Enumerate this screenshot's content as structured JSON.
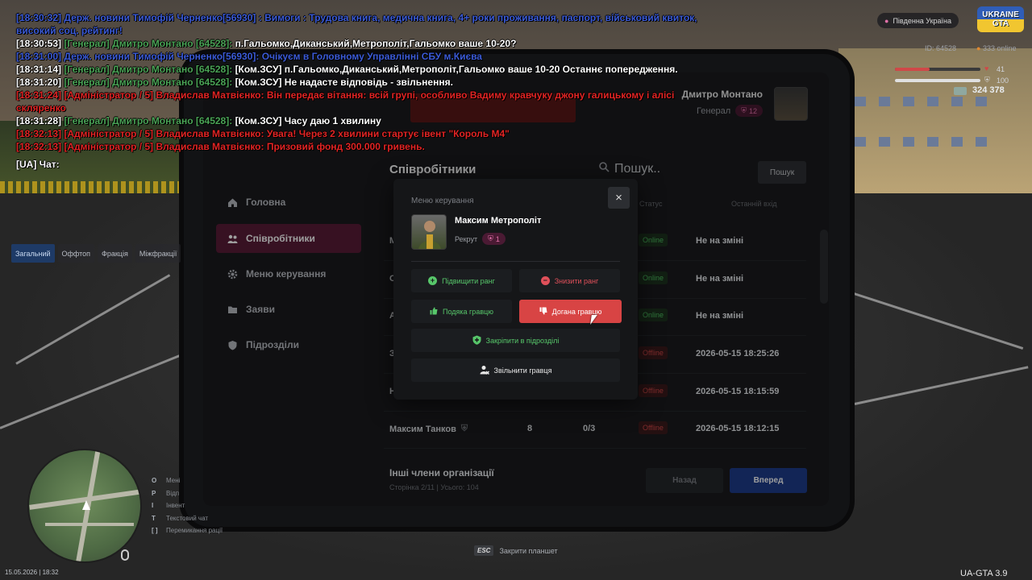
{
  "chat": {
    "lines": [
      {
        "time": "[18:30:32]",
        "tag": "Держ. новини",
        "author": "Тимофій Черненко[56930]",
        "text": ": Вимоги : Трудова книга, медична книга, 4+ роки проживання, паспорт, військовий квиток, високий соц. рейтинг!",
        "style": "news"
      },
      {
        "time": "[18:30:53]",
        "tag": "[Генерал]",
        "author": "Дмитро Монтано [64528]:",
        "text": "п.Гальомко,Диканський,Метрополіт,Гальомко ваше 10-20?",
        "style": "radio"
      },
      {
        "time": "[18:31:00]",
        "tag": "Держ. новини",
        "author": "Тимофій Черненко[56930]",
        "text": ": Очікуєм в Головному Управлінні СБУ м.Києва",
        "style": "news"
      },
      {
        "time": "[18:31:14]",
        "tag": "[Генерал]",
        "author": "Дмитро Монтано [64528]:",
        "text": "[Ком.ЗСУ] п.Гальомко,Диканський,Метрополіт,Гальомко ваше 10-20 Останнє попередження.",
        "style": "radio"
      },
      {
        "time": "[18:31:20]",
        "tag": "[Генерал]",
        "author": "Дмитро Монтано [64528]:",
        "text": "[Ком.ЗСУ] Не надасте відповідь - звільнення.",
        "style": "radio"
      },
      {
        "time": "[18:31:24]",
        "tag": "[Адміністратор / 5]",
        "author": "Владислав Матвієнко:",
        "text": "Він передає вітання: всій групі, особливо Вадиму кравчуку джону галицькому і алісі скляренко",
        "style": "admin"
      },
      {
        "time": "[18:31:28]",
        "tag": "[Генерал]",
        "author": "Дмитро Монтано [64528]:",
        "text": "[Ком.ЗСУ] Часу даю 1 хвилину",
        "style": "radio"
      },
      {
        "time": "[18:32:13]",
        "tag": "[Адміністратор / 5]",
        "author": "Владислав Матвієнко:",
        "text": "Увага! Через 2 хвилини стартує івент \"Король М4\"",
        "style": "admin"
      },
      {
        "time": "[18:32:13]",
        "tag": "[Адміністратор / 5]",
        "author": "Владислав Матвієнко:",
        "text": "Призовий фонд 300.000 гривень.",
        "style": "admin"
      }
    ],
    "input_prompt": "[UA] Чат:",
    "tabs": [
      "Загальний",
      "Оффтоп",
      "Фракція",
      "Міжфракції"
    ]
  },
  "hud": {
    "server": "Південна Україна",
    "logo_top": "UKRAINE",
    "logo_bottom": "GTA",
    "player_id": "ID: 64528",
    "online": "333 online",
    "health": 41,
    "armor": 100,
    "health_label": "41",
    "armor_label": "100",
    "money": "324 378",
    "date_time": "15.05.2026 | 18:32",
    "version": "UA-GTA 3.9"
  },
  "keys_hint": [
    {
      "key": "O",
      "label": "Мені"
    },
    {
      "key": "P",
      "label": "Відп"
    },
    {
      "key": "I",
      "label": "Інвент"
    },
    {
      "key": "T",
      "label": "Текстовий чат"
    },
    {
      "key": "[ ]",
      "label": "Перемикання рації"
    }
  ],
  "tablet": {
    "profile": {
      "name": "Дмитро Монтано",
      "rank": "Генерал",
      "rank_level": "12"
    },
    "sidebar": [
      {
        "label": "Головна",
        "icon": "home-icon"
      },
      {
        "label": "Співробітники",
        "icon": "users-icon",
        "active": true
      },
      {
        "label": "Меню керування",
        "icon": "gear-icon"
      },
      {
        "label": "Заяви",
        "icon": "folder-icon"
      },
      {
        "label": "Підрозділи",
        "icon": "shield-icon"
      }
    ],
    "section_title": "Співробітники",
    "search_placeholder": "Пошук..",
    "search_button": "Пошук",
    "columns": {
      "status": "Статус",
      "last_seen": "Останній вхід"
    },
    "rows": [
      {
        "name": "М",
        "level": "",
        "warns": "",
        "status": "Online",
        "last": "Не на зміні"
      },
      {
        "name": "С",
        "level": "",
        "warns": "",
        "status": "Online",
        "last": "Не на зміні"
      },
      {
        "name": "А",
        "level": "",
        "warns": "",
        "status": "Online",
        "last": "Не на зміні"
      },
      {
        "name": "З",
        "level": "",
        "warns": "",
        "status": "Offline",
        "last": "2026-05-15 18:25:26"
      },
      {
        "name": "Н",
        "level": "",
        "warns": "",
        "status": "Offline",
        "last": "2026-05-15 18:15:59"
      },
      {
        "name": "Максим Танков",
        "level": "8",
        "warns": "0/3",
        "status": "Offline",
        "last": "2026-05-15 18:12:15"
      }
    ],
    "other_members": "Інші члени організації",
    "pager": "Сторінка 2/11 | Усього: 104",
    "back_label": "Назад",
    "next_label": "Вперед"
  },
  "modal": {
    "title": "Меню керування",
    "close": "×",
    "player": "Максим Метрополіт",
    "rank": "Рекрут",
    "rank_level": "1",
    "buttons": {
      "promote": "Підвищити ранг",
      "demote": "Знизити ранг",
      "thank": "Подяка гравцю",
      "reprimand": "Догана гравцю",
      "assign": "Закріпити в підрозділі",
      "fire": "Звільнити гравця"
    }
  },
  "footer_hint": {
    "key": "ESC",
    "label": "Закрити планшет"
  }
}
